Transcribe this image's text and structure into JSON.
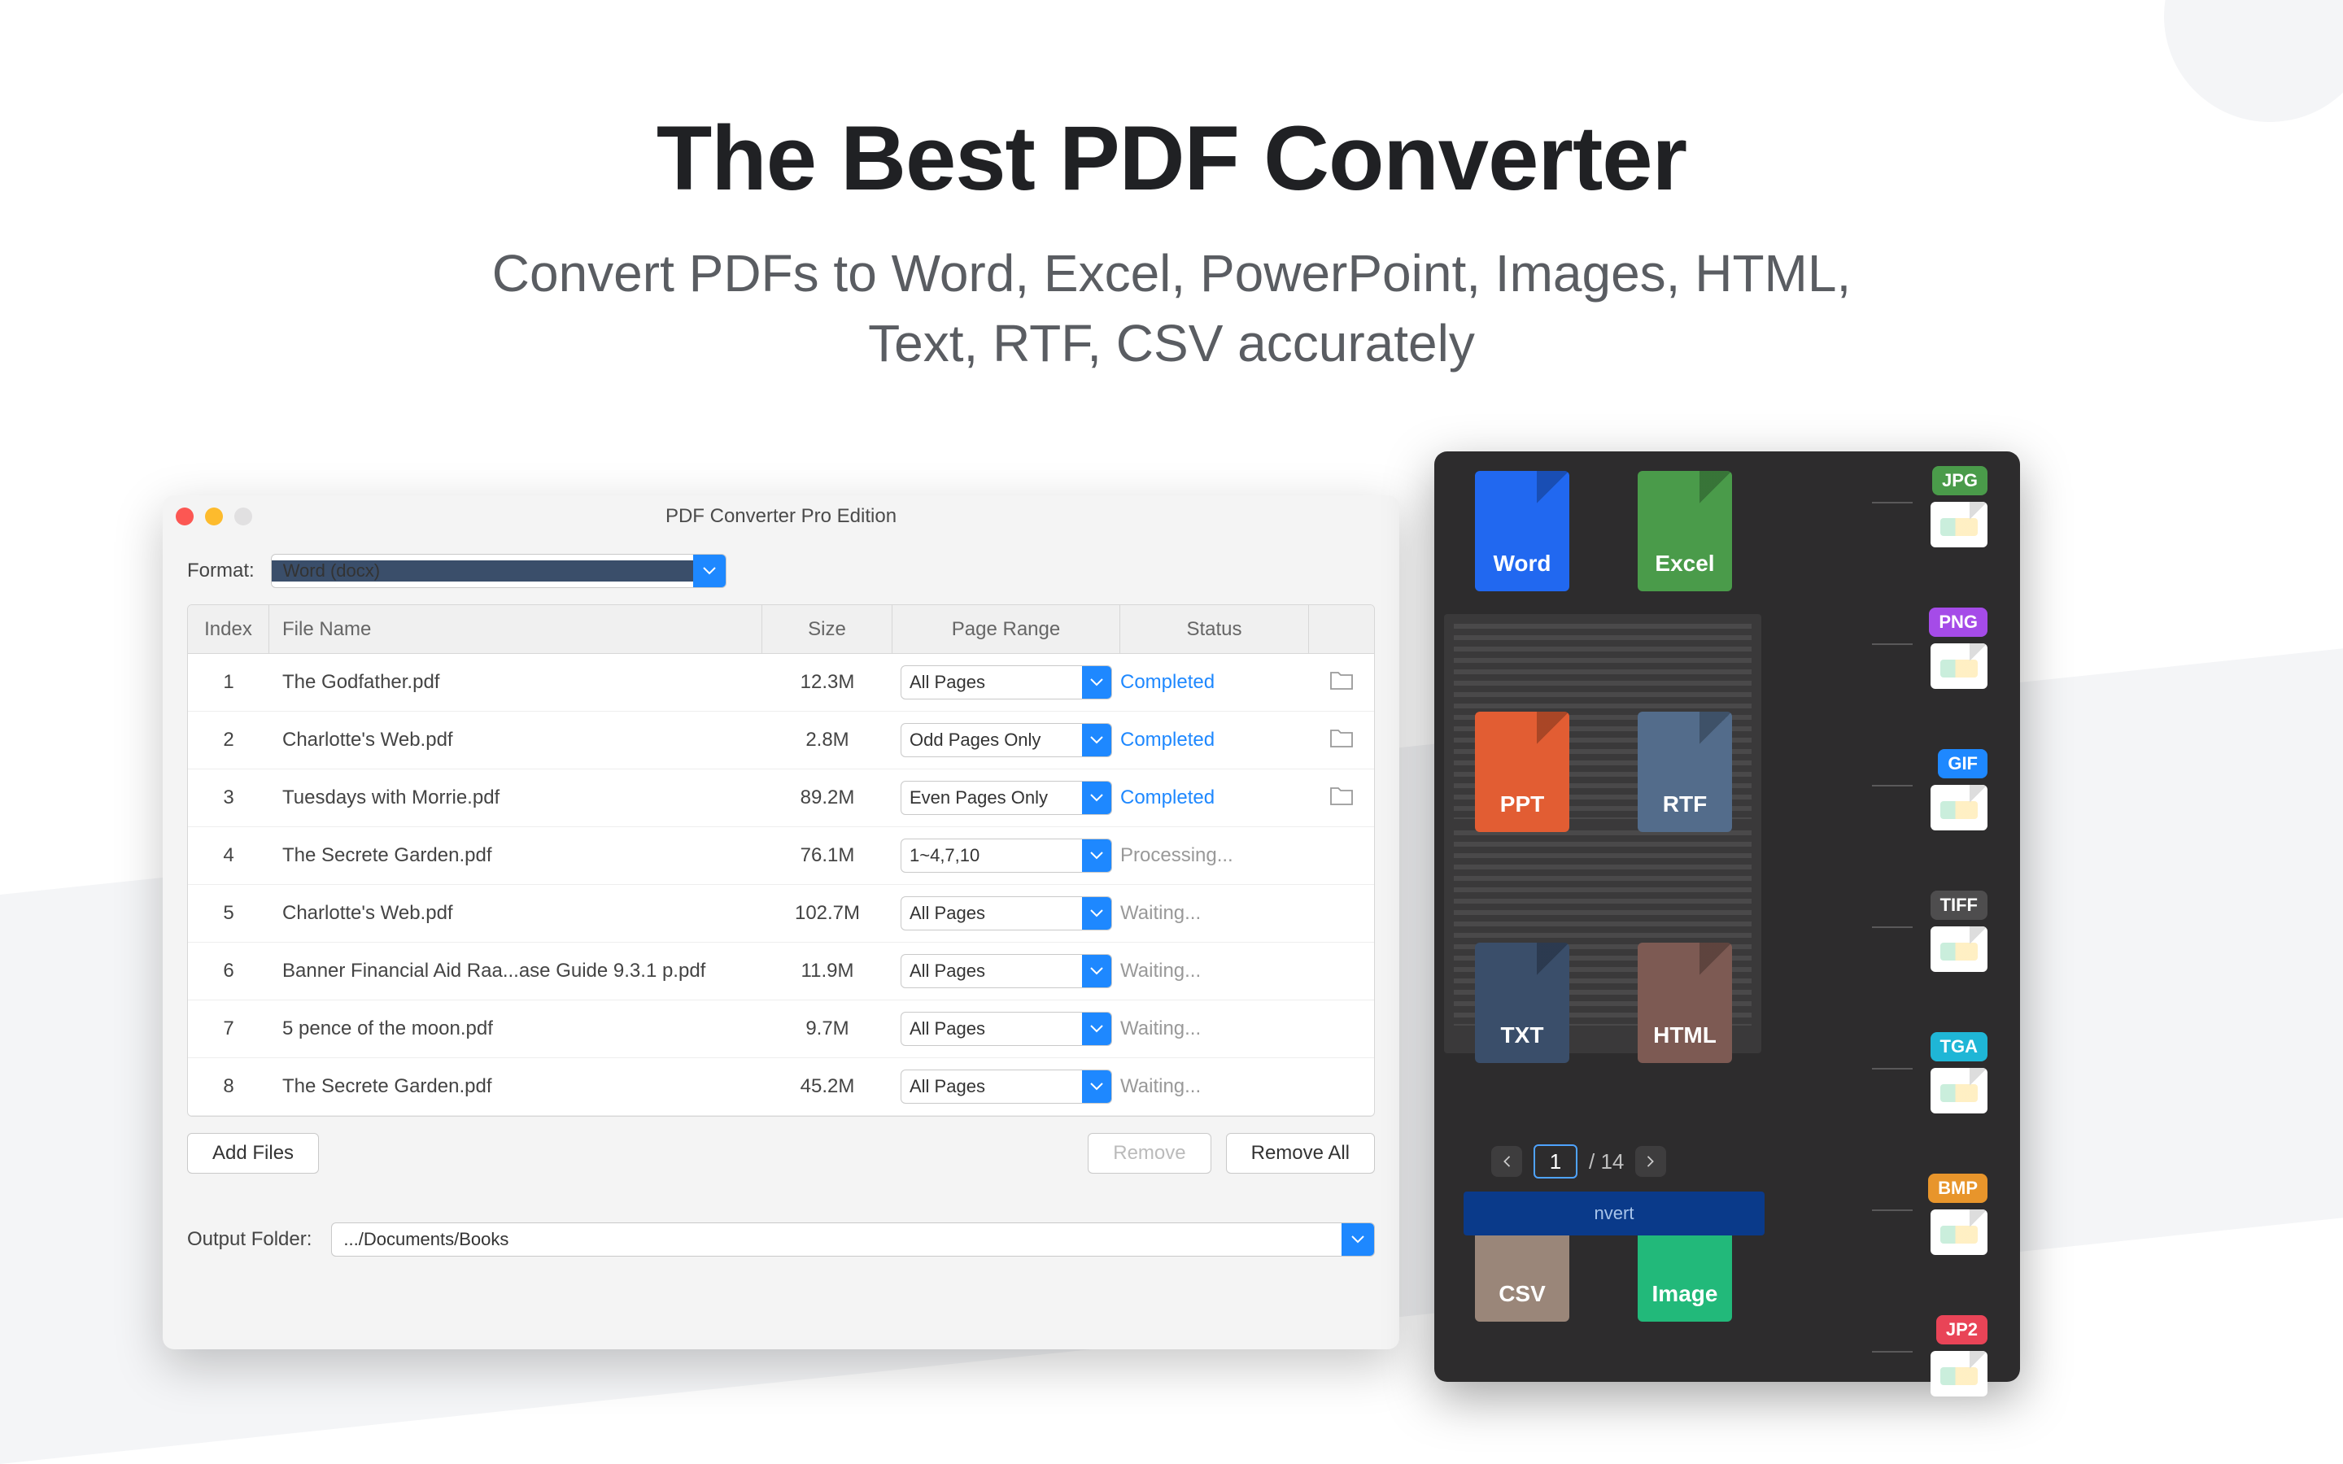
{
  "hero": {
    "title": "The Best PDF Converter",
    "subtitle_line1": "Convert PDFs to Word, Excel, PowerPoint, Images, HTML,",
    "subtitle_line2": "Text, RTF, CSV accurately"
  },
  "window": {
    "title": "PDF Converter Pro Edition",
    "format_label": "Format:",
    "format_value": "Word (docx)",
    "headers": {
      "index": "Index",
      "file_name": "File Name",
      "size": "Size",
      "page_range": "Page Range",
      "status": "Status"
    },
    "rows": [
      {
        "idx": "1",
        "name": "The Godfather.pdf",
        "size": "12.3M",
        "range": "All Pages",
        "status": "Completed",
        "status_class": "st-completed",
        "show_folder": true
      },
      {
        "idx": "2",
        "name": "Charlotte's Web.pdf",
        "size": "2.8M",
        "range": "Odd Pages Only",
        "status": "Completed",
        "status_class": "st-completed",
        "show_folder": true
      },
      {
        "idx": "3",
        "name": "Tuesdays with Morrie.pdf",
        "size": "89.2M",
        "range": "Even Pages Only",
        "status": "Completed",
        "status_class": "st-completed",
        "show_folder": true
      },
      {
        "idx": "4",
        "name": "The Secrete Garden.pdf",
        "size": "76.1M",
        "range": "1~4,7,10",
        "status": "Processing...",
        "status_class": "st-processing",
        "show_folder": false
      },
      {
        "idx": "5",
        "name": "Charlotte's Web.pdf",
        "size": "102.7M",
        "range": "All Pages",
        "status": "Waiting...",
        "status_class": "st-waiting",
        "show_folder": false
      },
      {
        "idx": "6",
        "name": "Banner Financial Aid Raa...ase Guide 9.3.1 p.pdf",
        "size": "11.9M",
        "range": "All Pages",
        "status": "Waiting...",
        "status_class": "st-waiting",
        "show_folder": false
      },
      {
        "idx": "7",
        "name": "5 pence of the moon.pdf",
        "size": "9.7M",
        "range": "All Pages",
        "status": "Waiting...",
        "status_class": "st-waiting",
        "show_folder": false
      },
      {
        "idx": "8",
        "name": "The Secrete Garden.pdf",
        "size": "45.2M",
        "range": "All Pages",
        "status": "Waiting...",
        "status_class": "st-waiting",
        "show_folder": false
      }
    ],
    "buttons": {
      "add_files": "Add Files",
      "remove": "Remove",
      "remove_all": "Remove All"
    },
    "output": {
      "label": "Output Folder:",
      "path": ".../Documents/Books"
    }
  },
  "preview": {
    "file_types": [
      {
        "label": "Word",
        "class": "word"
      },
      {
        "label": "Excel",
        "class": "excel"
      },
      {
        "label": "PPT",
        "class": "ppt"
      },
      {
        "label": "RTF",
        "class": "rtf"
      },
      {
        "label": "TXT",
        "class": "txt"
      },
      {
        "label": "HTML",
        "class": "html"
      },
      {
        "label": "CSV",
        "class": "csv"
      },
      {
        "label": "Image",
        "class": "image"
      }
    ],
    "pager": {
      "current": "1",
      "total": "/ 14"
    },
    "convert": "nvert",
    "image_tags": [
      {
        "label": "JPG",
        "class": "jpg"
      },
      {
        "label": "PNG",
        "class": "png"
      },
      {
        "label": "GIF",
        "class": "gif"
      },
      {
        "label": "TIFF",
        "class": "tiff"
      },
      {
        "label": "TGA",
        "class": "tga"
      },
      {
        "label": "BMP",
        "class": "bmp"
      },
      {
        "label": "JP2",
        "class": "jp2"
      }
    ]
  }
}
